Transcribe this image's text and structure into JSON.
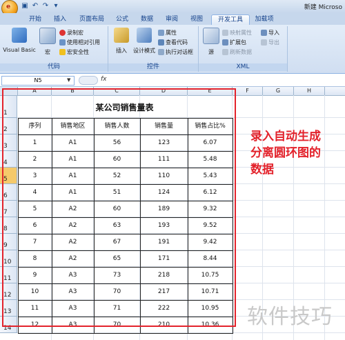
{
  "app": {
    "title": "新建 Microso",
    "office_button_label": "e",
    "quick_access": [
      "save-icon",
      "undo-icon",
      "redo-icon",
      "dropdown-icon"
    ]
  },
  "tabs": [
    "开始",
    "插入",
    "页面布局",
    "公式",
    "数据",
    "审阅",
    "视图",
    "开发工具",
    "加载项"
  ],
  "active_tab": "开发工具",
  "ribbon": {
    "code": {
      "label": "代码",
      "visual_basic": "Visual Basic",
      "macro": "宏",
      "record": "录制宏",
      "relative": "使用相对引用",
      "security": "宏安全性"
    },
    "controls": {
      "label": "控件",
      "insert": "插入",
      "design_mode": "设计模式",
      "properties": "属性",
      "view_code": "查看代码",
      "run_dialog": "执行对话框"
    },
    "xml": {
      "label": "XML",
      "source": "源",
      "map_props": "映射属性",
      "expansion": "扩展包",
      "refresh": "刷新数据",
      "import": "导入",
      "export": "导出"
    }
  },
  "formula_bar": {
    "name_box": "N5",
    "fx": "fx",
    "formula": ""
  },
  "columns": [
    "A",
    "B",
    "C",
    "D",
    "E",
    "F",
    "G",
    "H"
  ],
  "rows": [
    "1",
    "2",
    "3",
    "4",
    "5",
    "6",
    "7",
    "8",
    "9",
    "10",
    "11",
    "12",
    "13",
    "14"
  ],
  "selected_row": "5",
  "table": {
    "title": "某公司销售量表",
    "headers": [
      "序列",
      "销售地区",
      "销售人数",
      "销售量",
      "销售占比%"
    ],
    "data": [
      [
        "1",
        "A1",
        "56",
        "123",
        "6.07"
      ],
      [
        "2",
        "A1",
        "60",
        "111",
        "5.48"
      ],
      [
        "3",
        "A1",
        "52",
        "110",
        "5.43"
      ],
      [
        "4",
        "A1",
        "51",
        "124",
        "6.12"
      ],
      [
        "5",
        "A2",
        "60",
        "189",
        "9.32"
      ],
      [
        "6",
        "A2",
        "63",
        "193",
        "9.52"
      ],
      [
        "7",
        "A2",
        "67",
        "191",
        "9.42"
      ],
      [
        "8",
        "A2",
        "65",
        "171",
        "8.44"
      ],
      [
        "9",
        "A3",
        "73",
        "218",
        "10.75"
      ],
      [
        "10",
        "A3",
        "70",
        "217",
        "10.71"
      ],
      [
        "11",
        "A3",
        "71",
        "222",
        "10.95"
      ],
      [
        "12",
        "A3",
        "70",
        "210",
        "10.36"
      ]
    ]
  },
  "annotation": {
    "lines": [
      "录入自动生成",
      "分离圆环图的",
      "数据"
    ]
  },
  "watermark": "软件技巧",
  "colors": {
    "annotation_red": "#e3222b",
    "ribbon_blue": "#15428b",
    "selected_header": "#f5c96a"
  }
}
